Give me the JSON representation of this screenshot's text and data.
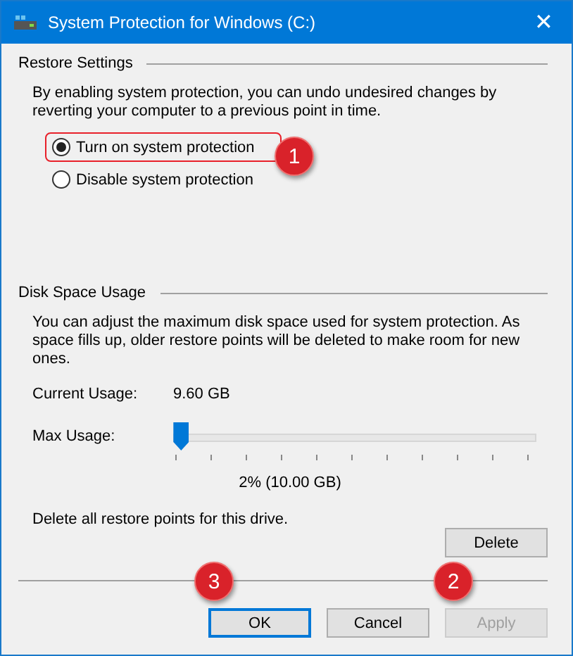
{
  "window": {
    "title": "System Protection for Windows (C:)",
    "close": "✕"
  },
  "restore_settings": {
    "heading": "Restore Settings",
    "description": "By enabling system protection, you can undo undesired changes by reverting your computer to a previous point in time.",
    "options": [
      {
        "label": "Turn on system protection",
        "selected": true,
        "highlighted": true
      },
      {
        "label": "Disable system protection",
        "selected": false,
        "highlighted": false
      }
    ]
  },
  "disk_space_usage": {
    "heading": "Disk Space Usage",
    "description": "You can adjust the maximum disk space used for system protection. As space fills up, older restore points will be deleted to make room for new ones.",
    "current_usage_label": "Current Usage:",
    "current_usage_value": "9.60 GB",
    "max_usage_label": "Max Usage:",
    "max_usage": {
      "level": 0.02
    },
    "max_usage_reading": "2% (10.00 GB)",
    "delete_text": "Delete all restore points for this drive.",
    "delete_button": "Delete"
  },
  "buttons": [
    {
      "label": "OK",
      "focused": true,
      "disabled": false
    },
    {
      "label": "Cancel",
      "focused": false,
      "disabled": false
    },
    {
      "label": "Apply",
      "focused": false,
      "disabled": true
    }
  ],
  "step_badges": [
    {
      "label": "1"
    },
    {
      "label": "2"
    },
    {
      "label": "3"
    }
  ]
}
